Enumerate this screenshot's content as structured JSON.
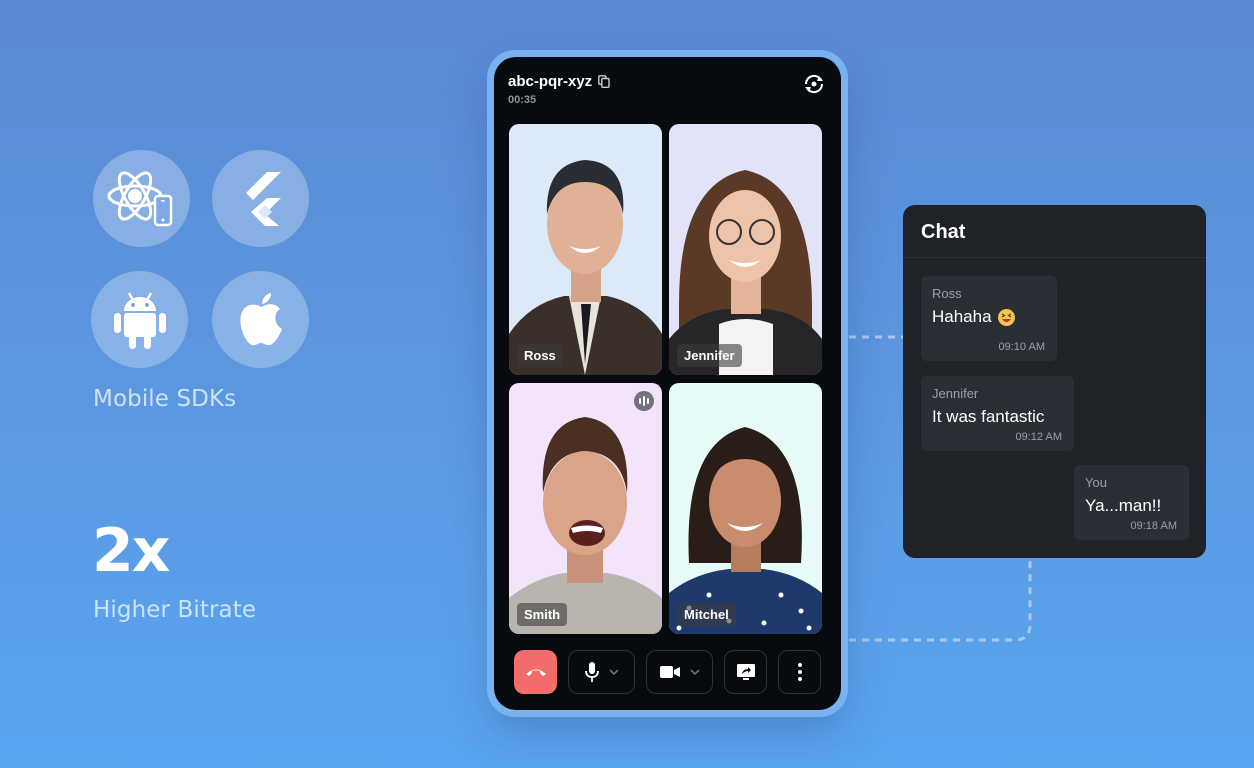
{
  "left_panel": {
    "sdk_icons": [
      {
        "name": "react-native-icon"
      },
      {
        "name": "flutter-icon"
      },
      {
        "name": "android-icon"
      },
      {
        "name": "apple-icon"
      }
    ],
    "sdk_label": "Mobile SDKs",
    "stat_value": "2x",
    "stat_label": "Higher Bitrate"
  },
  "call": {
    "meeting_id": "abc-pqr-xyz",
    "timer": "00:35",
    "participants": [
      {
        "name": "Ross",
        "speaking": false
      },
      {
        "name": "Jennifer",
        "speaking": false
      },
      {
        "name": "Smith",
        "speaking": true
      },
      {
        "name": "Mitchel",
        "speaking": false
      }
    ],
    "controls": [
      "end-call",
      "microphone",
      "camera",
      "screen-share",
      "more-options"
    ]
  },
  "chat": {
    "title": "Chat",
    "messages": [
      {
        "sender": "Ross",
        "text": "Hahaha",
        "emoji": "laughing",
        "time": "09:10 AM"
      },
      {
        "sender": "Jennifer",
        "text": "It was fantastic",
        "time": "09:12 AM"
      },
      {
        "sender": "You",
        "text": "Ya...man!!",
        "time": "09:18 AM"
      }
    ]
  },
  "colors": {
    "end_call": "#f26c6c",
    "phone_frame": "#79b2ef",
    "chat_bg": "#1f2226"
  }
}
